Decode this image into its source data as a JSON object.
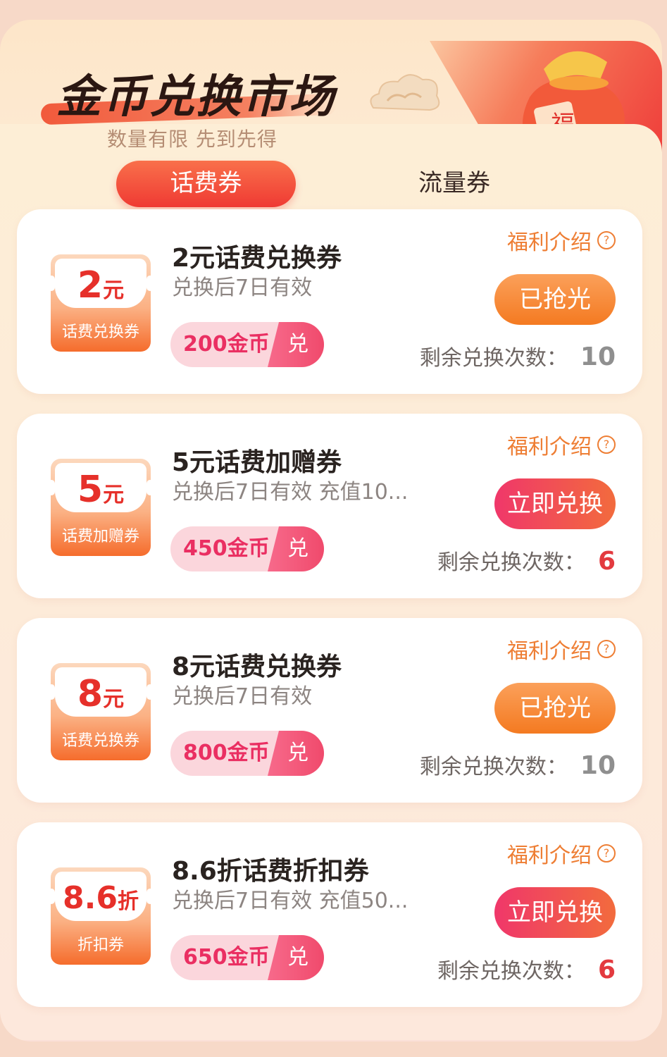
{
  "header": {
    "title": "金币兑换市场",
    "subtitle": "数量有限 先到先得",
    "bag_text": "福"
  },
  "tabs": [
    {
      "label": "话费券",
      "active": true
    },
    {
      "label": "流量券",
      "active": false
    }
  ],
  "cards": [
    {
      "amount": "2",
      "unit": "元",
      "ticket_label": "话费兑换券",
      "title": "2元话费兑换券",
      "desc": "兑换后7日有效",
      "price": "200金币",
      "exchange_tag": "兑",
      "intro": "福利介绍",
      "intro_icon": "?",
      "button": "已抢光",
      "button_state": "sold-out",
      "remain_label": "剩余兑换次数：",
      "remain": "10"
    },
    {
      "amount": "5",
      "unit": "元",
      "ticket_label": "话费加赠券",
      "title": "5元话费加赠券",
      "desc": "兑换后7日有效 充值10...",
      "price": "450金币",
      "exchange_tag": "兑",
      "intro": "福利介绍",
      "intro_icon": "?",
      "button": "立即兑换",
      "button_state": "available",
      "remain_label": "剩余兑换次数：",
      "remain": "6"
    },
    {
      "amount": "8",
      "unit": "元",
      "ticket_label": "话费兑换券",
      "title": "8元话费兑换券",
      "desc": "兑换后7日有效",
      "price": "800金币",
      "exchange_tag": "兑",
      "intro": "福利介绍",
      "intro_icon": "?",
      "button": "已抢光",
      "button_state": "sold-out",
      "remain_label": "剩余兑换次数：",
      "remain": "10"
    },
    {
      "amount": "8.6",
      "unit": "折",
      "ticket_label": "折扣券",
      "title": "8.6折话费折扣券",
      "desc": "兑换后7日有效 充值50...",
      "price": "650金币",
      "exchange_tag": "兑",
      "intro": "福利介绍",
      "intro_icon": "?",
      "button": "立即兑换",
      "button_state": "available",
      "remain_label": "剩余兑换次数：",
      "remain": "6"
    }
  ],
  "colors": {
    "accent_red": "#ef3a33",
    "accent_orange": "#f47a21",
    "coin_pink": "#ea2f62",
    "intro_orange": "#ee7e34"
  }
}
